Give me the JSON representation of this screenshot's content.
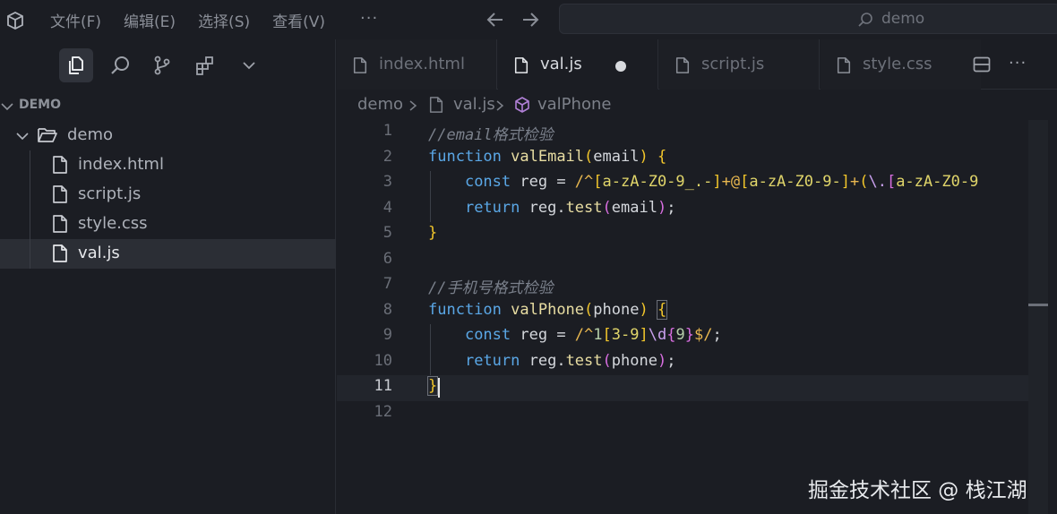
{
  "menu": [
    "文件(F)",
    "编辑(E)",
    "选择(S)",
    "查看(V)"
  ],
  "menu_more": "···",
  "command_center": {
    "text": "demo"
  },
  "explorer": {
    "section_title": "DEMO",
    "folder": "demo",
    "files": [
      "index.html",
      "script.js",
      "style.css",
      "val.js"
    ],
    "selected": "val.js"
  },
  "tabs": [
    {
      "label": "index.html",
      "active": false
    },
    {
      "label": "val.js",
      "active": true,
      "dirty": true
    },
    {
      "label": "script.js",
      "active": false
    },
    {
      "label": "style.css",
      "active": false
    }
  ],
  "tab_more": "···",
  "breadcrumb": [
    "demo",
    "val.js",
    "valPhone"
  ],
  "code": {
    "line_numbers": [
      "1",
      "2",
      "3",
      "4",
      "5",
      "6",
      "7",
      "8",
      "9",
      "10",
      "11",
      "12"
    ],
    "current_line": 11,
    "lines": [
      "//email格式检验",
      "function valEmail(email) {",
      "    const reg = /^[a-zA-Z0-9_.-]+@[a-zA-Z0-9-]+(\\.[a-zA-Z0-9",
      "    return reg.test(email);",
      "}",
      "",
      "//手机号格式检验",
      "function valPhone(phone) {",
      "    const reg = /^1[3-9]\\d{9}$/;",
      "    return reg.test(phone);",
      "}",
      ""
    ]
  },
  "watermark": "掘金技术社区 @ 栈江湖",
  "colors": {
    "background": "#1b1d23",
    "keyword": "#5aa7e6",
    "function_name": "#e8dda2",
    "comment": "#7b818c",
    "bracket_1": "#f2c62b",
    "bracket_2": "#d86ee0"
  }
}
